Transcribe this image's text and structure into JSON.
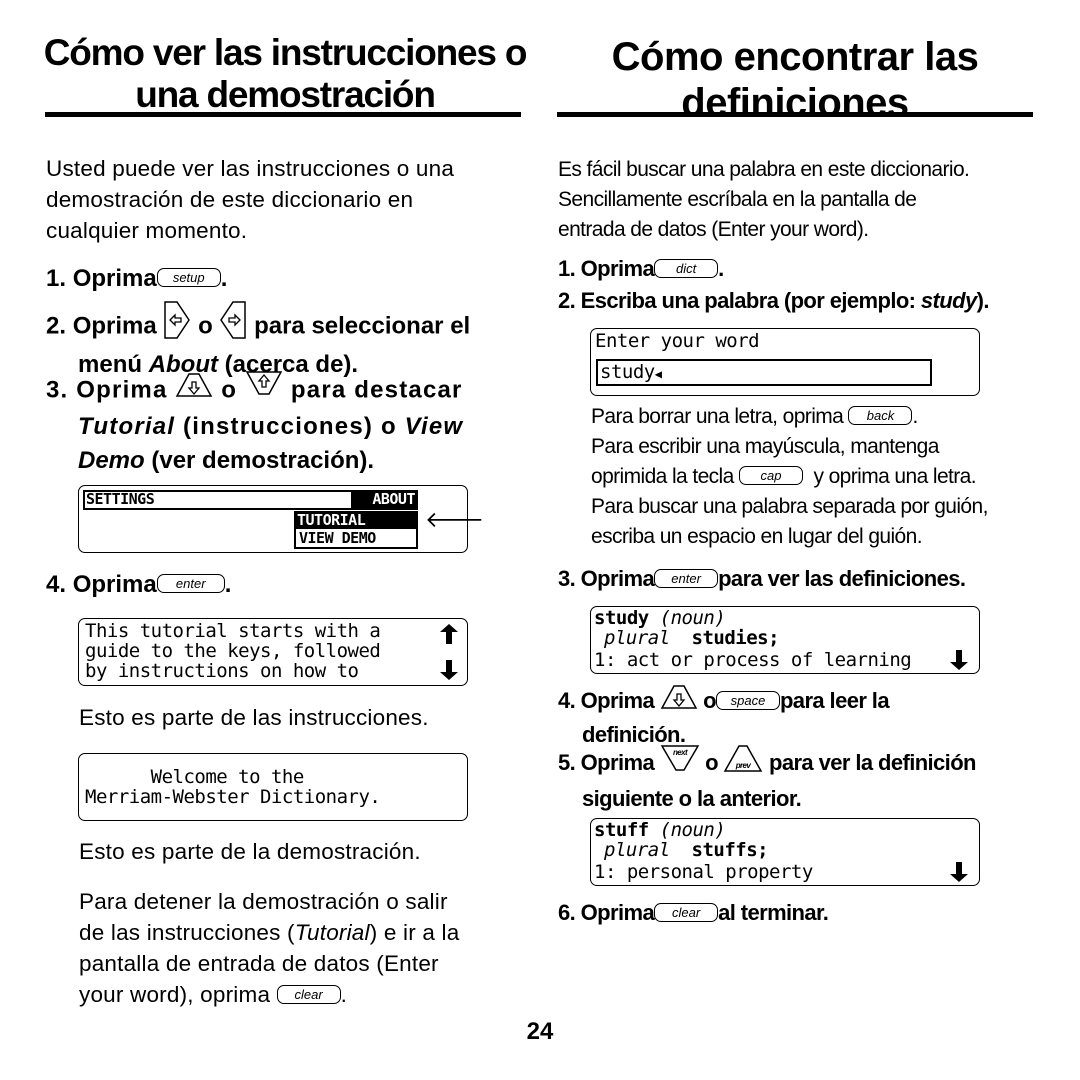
{
  "left": {
    "title_line1": "Cómo ver las instrucciones o",
    "title_line2": "una demostración",
    "intro": [
      "Usted puede ver las instrucciones o una",
      "demostración de este diccionario en",
      "cualquier momento."
    ],
    "step1": {
      "num": "1.",
      "text": "Oprima",
      "key": "setup",
      "end": "."
    },
    "step2": {
      "num": "2.",
      "text": "Oprima",
      "or": "o",
      "rest": "para seleccionar el",
      "line2_a": "menú ",
      "line2_italic": "About",
      "line2_b": " (acerca de).",
      "key1_icon": "left-arrow-key",
      "key2_icon": "right-arrow-key"
    },
    "step3": {
      "num": "3.",
      "text": "Oprima",
      "or": "o",
      "rest": "para destacar",
      "line2_italic1": "Tutorial",
      "line2_mid": " (instrucciones) o ",
      "line2_italic2": "View",
      "line3_italic": "Demo",
      "line3_rest": " (ver demostración).",
      "key1_icon": "down-arrow-key",
      "key2_icon": "up-arrow-key"
    },
    "screen_menu": {
      "settings": "SETTINGS",
      "about": "ABOUT",
      "tutorial": "TUTORIAL",
      "view_demo": "VIEW DEMO"
    },
    "step4": {
      "num": "4.",
      "text": "Oprima",
      "key": "enter",
      "end": "."
    },
    "screen_tutorial": [
      "This tutorial starts with a",
      "guide to the keys, followed",
      "by instructions on how to"
    ],
    "caption_tutorial": "Esto es parte de las instrucciones.",
    "screen_demo": [
      "      Welcome to the",
      "Merriam-Webster Dictionary."
    ],
    "caption_demo": "Esto es parte de la demostración.",
    "outro": {
      "l1": "Para detener la demostración o salir",
      "l2a": "de las instrucciones (",
      "l2_italic": "Tutorial",
      "l2b": ") e ir a la",
      "l3": "pantalla de entrada de datos (Enter",
      "l4": "your word), oprima",
      "key": "clear",
      "end": "."
    }
  },
  "right": {
    "title_line1": "Cómo encontrar las",
    "title_line2": "definiciones",
    "intro": [
      "Es fácil buscar una palabra en este diccionario.",
      "Sencillamente escríbala en la pantalla de",
      "entrada de datos (Enter your word)."
    ],
    "step1": {
      "num": "1.",
      "text": "Oprima",
      "key": "dict",
      "end": "."
    },
    "step2": {
      "num": "2.",
      "text": "Escriba una palabra (por ejemplo: ",
      "italic": "study",
      "end": ")."
    },
    "screen_entry": {
      "prompt": "Enter your word",
      "value": "study"
    },
    "notes": {
      "l1": "Para borrar una letra, oprima",
      "l1_key": "back",
      "l1_end": ".",
      "l2": "Para escribir una mayúscula, mantenga",
      "l3a": "oprimida la tecla",
      "l3_key": "cap",
      "l3b": "y oprima una letra.",
      "l4": "Para buscar una palabra separada por guión,",
      "l5": "escriba un espacio en lugar del guión."
    },
    "step3": {
      "num": "3.",
      "text": "Oprima",
      "key": "enter",
      "rest": "para ver las definiciones."
    },
    "screen_study": {
      "word": "study",
      "pos": "(noun)",
      "plural_label": "plural",
      "plural": "studies;",
      "def": "1: act or process of learning"
    },
    "step4": {
      "num": "4.",
      "text": "Oprima",
      "or": "o",
      "key": "space",
      "rest": "para leer la",
      "line2": "definición."
    },
    "step5": {
      "num": "5.",
      "text": "Oprima",
      "key1": "next",
      "or": "o",
      "key2": "prev",
      "rest": "para ver la definición",
      "line2": "siguiente o la anterior."
    },
    "screen_stuff": {
      "word": "stuff",
      "pos": "(noun)",
      "plural_label": "plural",
      "plural": "stuffs;",
      "def": "1: personal property"
    },
    "step6": {
      "num": "6.",
      "text": "Oprima",
      "key": "clear",
      "rest": "al terminar."
    }
  },
  "page_number": "24"
}
